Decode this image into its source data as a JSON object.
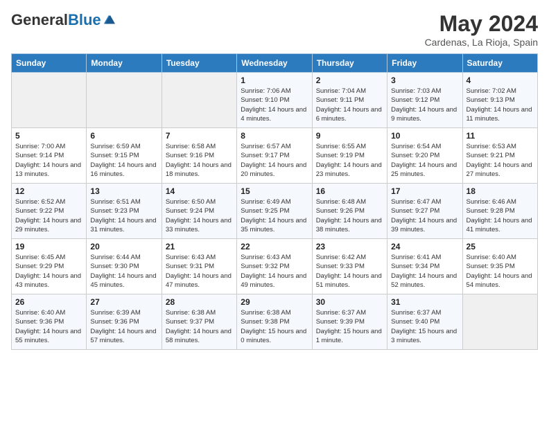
{
  "header": {
    "logo_general": "General",
    "logo_blue": "Blue",
    "month_title": "May 2024",
    "location": "Cardenas, La Rioja, Spain"
  },
  "days_of_week": [
    "Sunday",
    "Monday",
    "Tuesday",
    "Wednesday",
    "Thursday",
    "Friday",
    "Saturday"
  ],
  "weeks": [
    [
      {
        "day": "",
        "sunrise": "",
        "sunset": "",
        "daylight": ""
      },
      {
        "day": "",
        "sunrise": "",
        "sunset": "",
        "daylight": ""
      },
      {
        "day": "",
        "sunrise": "",
        "sunset": "",
        "daylight": ""
      },
      {
        "day": "1",
        "sunrise": "Sunrise: 7:06 AM",
        "sunset": "Sunset: 9:10 PM",
        "daylight": "Daylight: 14 hours and 4 minutes."
      },
      {
        "day": "2",
        "sunrise": "Sunrise: 7:04 AM",
        "sunset": "Sunset: 9:11 PM",
        "daylight": "Daylight: 14 hours and 6 minutes."
      },
      {
        "day": "3",
        "sunrise": "Sunrise: 7:03 AM",
        "sunset": "Sunset: 9:12 PM",
        "daylight": "Daylight: 14 hours and 9 minutes."
      },
      {
        "day": "4",
        "sunrise": "Sunrise: 7:02 AM",
        "sunset": "Sunset: 9:13 PM",
        "daylight": "Daylight: 14 hours and 11 minutes."
      }
    ],
    [
      {
        "day": "5",
        "sunrise": "Sunrise: 7:00 AM",
        "sunset": "Sunset: 9:14 PM",
        "daylight": "Daylight: 14 hours and 13 minutes."
      },
      {
        "day": "6",
        "sunrise": "Sunrise: 6:59 AM",
        "sunset": "Sunset: 9:15 PM",
        "daylight": "Daylight: 14 hours and 16 minutes."
      },
      {
        "day": "7",
        "sunrise": "Sunrise: 6:58 AM",
        "sunset": "Sunset: 9:16 PM",
        "daylight": "Daylight: 14 hours and 18 minutes."
      },
      {
        "day": "8",
        "sunrise": "Sunrise: 6:57 AM",
        "sunset": "Sunset: 9:17 PM",
        "daylight": "Daylight: 14 hours and 20 minutes."
      },
      {
        "day": "9",
        "sunrise": "Sunrise: 6:55 AM",
        "sunset": "Sunset: 9:19 PM",
        "daylight": "Daylight: 14 hours and 23 minutes."
      },
      {
        "day": "10",
        "sunrise": "Sunrise: 6:54 AM",
        "sunset": "Sunset: 9:20 PM",
        "daylight": "Daylight: 14 hours and 25 minutes."
      },
      {
        "day": "11",
        "sunrise": "Sunrise: 6:53 AM",
        "sunset": "Sunset: 9:21 PM",
        "daylight": "Daylight: 14 hours and 27 minutes."
      }
    ],
    [
      {
        "day": "12",
        "sunrise": "Sunrise: 6:52 AM",
        "sunset": "Sunset: 9:22 PM",
        "daylight": "Daylight: 14 hours and 29 minutes."
      },
      {
        "day": "13",
        "sunrise": "Sunrise: 6:51 AM",
        "sunset": "Sunset: 9:23 PM",
        "daylight": "Daylight: 14 hours and 31 minutes."
      },
      {
        "day": "14",
        "sunrise": "Sunrise: 6:50 AM",
        "sunset": "Sunset: 9:24 PM",
        "daylight": "Daylight: 14 hours and 33 minutes."
      },
      {
        "day": "15",
        "sunrise": "Sunrise: 6:49 AM",
        "sunset": "Sunset: 9:25 PM",
        "daylight": "Daylight: 14 hours and 35 minutes."
      },
      {
        "day": "16",
        "sunrise": "Sunrise: 6:48 AM",
        "sunset": "Sunset: 9:26 PM",
        "daylight": "Daylight: 14 hours and 38 minutes."
      },
      {
        "day": "17",
        "sunrise": "Sunrise: 6:47 AM",
        "sunset": "Sunset: 9:27 PM",
        "daylight": "Daylight: 14 hours and 39 minutes."
      },
      {
        "day": "18",
        "sunrise": "Sunrise: 6:46 AM",
        "sunset": "Sunset: 9:28 PM",
        "daylight": "Daylight: 14 hours and 41 minutes."
      }
    ],
    [
      {
        "day": "19",
        "sunrise": "Sunrise: 6:45 AM",
        "sunset": "Sunset: 9:29 PM",
        "daylight": "Daylight: 14 hours and 43 minutes."
      },
      {
        "day": "20",
        "sunrise": "Sunrise: 6:44 AM",
        "sunset": "Sunset: 9:30 PM",
        "daylight": "Daylight: 14 hours and 45 minutes."
      },
      {
        "day": "21",
        "sunrise": "Sunrise: 6:43 AM",
        "sunset": "Sunset: 9:31 PM",
        "daylight": "Daylight: 14 hours and 47 minutes."
      },
      {
        "day": "22",
        "sunrise": "Sunrise: 6:43 AM",
        "sunset": "Sunset: 9:32 PM",
        "daylight": "Daylight: 14 hours and 49 minutes."
      },
      {
        "day": "23",
        "sunrise": "Sunrise: 6:42 AM",
        "sunset": "Sunset: 9:33 PM",
        "daylight": "Daylight: 14 hours and 51 minutes."
      },
      {
        "day": "24",
        "sunrise": "Sunrise: 6:41 AM",
        "sunset": "Sunset: 9:34 PM",
        "daylight": "Daylight: 14 hours and 52 minutes."
      },
      {
        "day": "25",
        "sunrise": "Sunrise: 6:40 AM",
        "sunset": "Sunset: 9:35 PM",
        "daylight": "Daylight: 14 hours and 54 minutes."
      }
    ],
    [
      {
        "day": "26",
        "sunrise": "Sunrise: 6:40 AM",
        "sunset": "Sunset: 9:36 PM",
        "daylight": "Daylight: 14 hours and 55 minutes."
      },
      {
        "day": "27",
        "sunrise": "Sunrise: 6:39 AM",
        "sunset": "Sunset: 9:36 PM",
        "daylight": "Daylight: 14 hours and 57 minutes."
      },
      {
        "day": "28",
        "sunrise": "Sunrise: 6:38 AM",
        "sunset": "Sunset: 9:37 PM",
        "daylight": "Daylight: 14 hours and 58 minutes."
      },
      {
        "day": "29",
        "sunrise": "Sunrise: 6:38 AM",
        "sunset": "Sunset: 9:38 PM",
        "daylight": "Daylight: 15 hours and 0 minutes."
      },
      {
        "day": "30",
        "sunrise": "Sunrise: 6:37 AM",
        "sunset": "Sunset: 9:39 PM",
        "daylight": "Daylight: 15 hours and 1 minute."
      },
      {
        "day": "31",
        "sunrise": "Sunrise: 6:37 AM",
        "sunset": "Sunset: 9:40 PM",
        "daylight": "Daylight: 15 hours and 3 minutes."
      },
      {
        "day": "",
        "sunrise": "",
        "sunset": "",
        "daylight": ""
      }
    ]
  ]
}
